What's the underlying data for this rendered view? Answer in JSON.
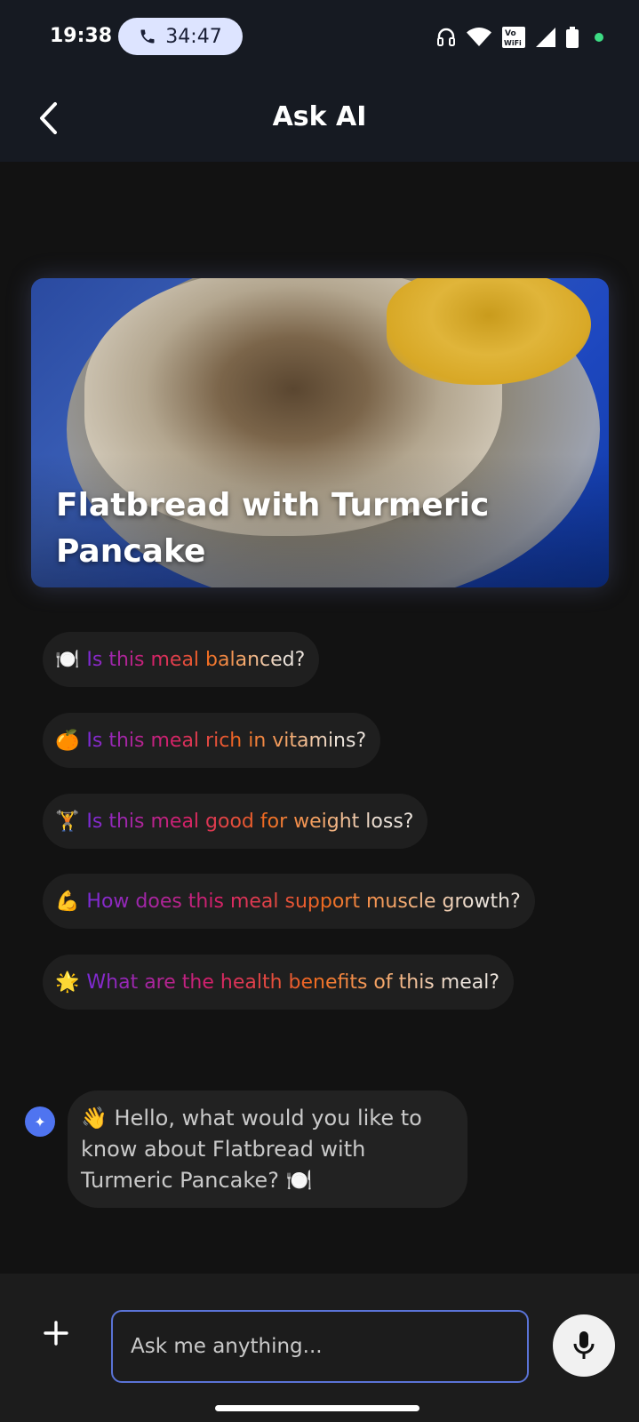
{
  "status_bar": {
    "time": "19:38",
    "call_timer": "34:47",
    "icons": [
      "headset-icon",
      "wifi-icon",
      "vowifi-icon",
      "signal-icon",
      "battery-icon",
      "green-dot"
    ],
    "vowifi_label": "Vo\nWiFi"
  },
  "header": {
    "title": "Ask AI",
    "back_icon": "chevron-left-icon"
  },
  "hero": {
    "title": "Flatbread with Turmeric Pancake"
  },
  "suggestions": [
    {
      "emoji": "🍽️",
      "text": "Is this meal balanced?"
    },
    {
      "emoji": "🍊",
      "text": "Is this meal rich in vitamins?"
    },
    {
      "emoji": "🏋️",
      "text": "Is this meal good for weight loss?"
    },
    {
      "emoji": "💪",
      "text": "How does this meal support muscle growth?"
    },
    {
      "emoji": "🌟",
      "text": "What are the health benefits of this meal?"
    }
  ],
  "chat": {
    "avatar_icon": "sparkle-icon",
    "avatar_glyph": "✦",
    "message": "👋 Hello, what would you like to know about Flatbread with Turmeric Pancake? 🍽️"
  },
  "input": {
    "placeholder": "Ask me anything...",
    "add_icon": "plus-icon",
    "mic_icon": "microphone-icon"
  },
  "colors": {
    "background": "#121212",
    "bar": "#161a22",
    "chip": "#1f1f1f",
    "accent_blue": "#4f74f0",
    "input_border": "#5a73d6",
    "call_pill": "#dde4ff"
  }
}
